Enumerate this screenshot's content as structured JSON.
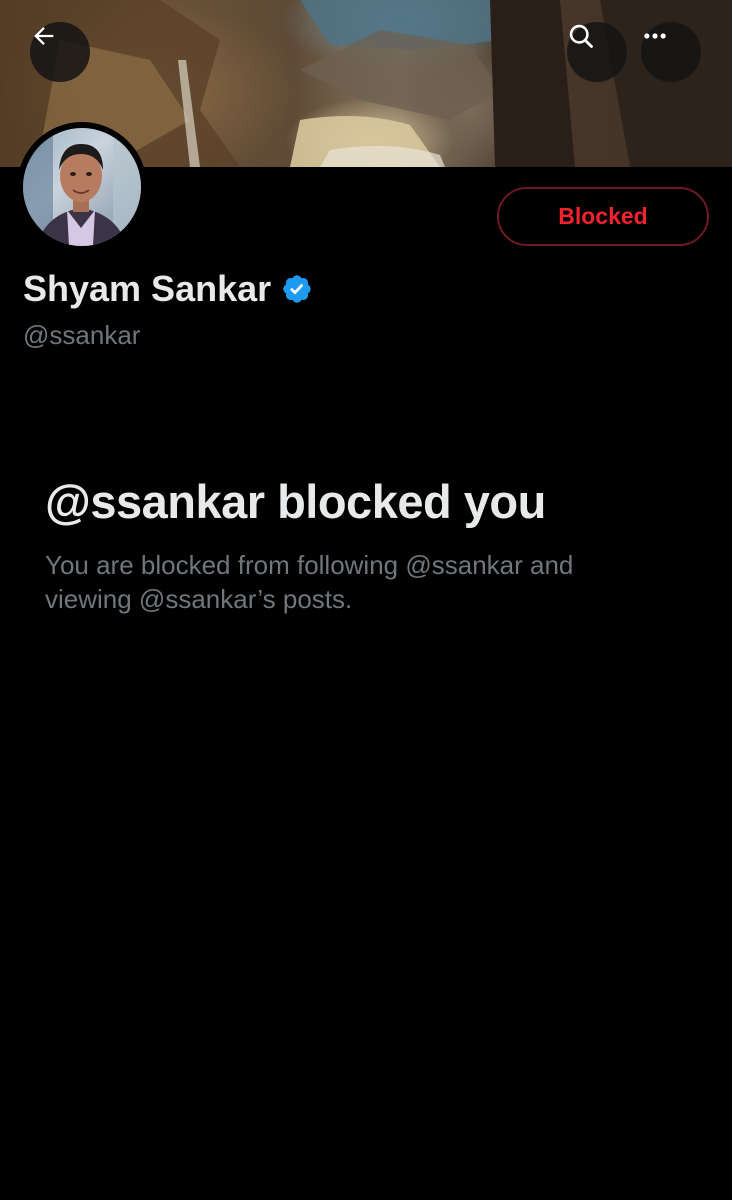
{
  "profile": {
    "display_name": "Shyam Sankar",
    "handle": "@ssankar",
    "verified": true,
    "verified_color": "#1d9bf0"
  },
  "actions": {
    "blocked_label": "Blocked",
    "blocked_color": "#f4212e"
  },
  "header": {
    "back_icon": "arrow-left-icon",
    "search_icon": "search-icon",
    "more_icon": "more-horizontal-icon"
  },
  "blocked_notice": {
    "title": "@ssankar blocked you",
    "description": "You are blocked from following @ssankar and viewing @ssankar’s posts."
  }
}
